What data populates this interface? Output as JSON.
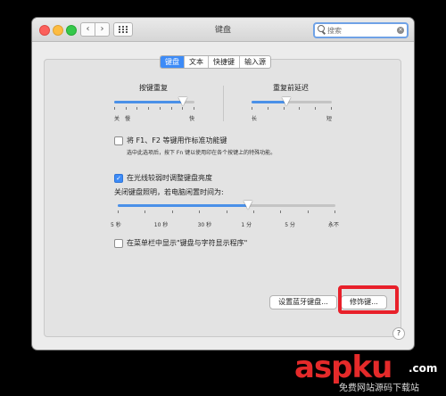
{
  "window": {
    "title": "键盘"
  },
  "toolbar": {
    "back_glyph": "‹",
    "forward_glyph": "›"
  },
  "search": {
    "placeholder": "搜索",
    "clear_glyph": "×"
  },
  "tabs": [
    {
      "label": "键盘",
      "active": true
    },
    {
      "label": "文本",
      "active": false
    },
    {
      "label": "快捷键",
      "active": false
    },
    {
      "label": "输入源",
      "active": false
    }
  ],
  "key_repeat": {
    "title": "按键重复",
    "min_label_1": "关",
    "min_label_2": "慢",
    "max_label": "快",
    "value_fraction": 0.85
  },
  "delay_until_repeat": {
    "title": "重复前延迟",
    "min_label": "长",
    "max_label": "短",
    "value_fraction": 0.43
  },
  "fn_keys": {
    "checked": false,
    "label": "将 F1、F2 等键用作标准功能键",
    "note": "选中此选项后，按下 Fn 键以使用印在各个按键上的特殊功能。"
  },
  "backlight": {
    "checked": true,
    "checkmark": "✓",
    "label": "在光线较弱时调整键盘亮度",
    "timeout_label": "关闭键盘照明，若电脑闲置时间为:",
    "ticks": [
      "5 秒",
      "10 秒",
      "30 秒",
      "1 分",
      "5 分",
      "永不"
    ],
    "value_fraction": 0.6
  },
  "menu_bar": {
    "checked": false,
    "label": "在菜单栏中显示\"键盘与字符显示程序\""
  },
  "buttons": {
    "bluetooth": "设置蓝牙键盘...",
    "modifier": "修饰键..."
  },
  "help": {
    "glyph": "?"
  },
  "watermark": {
    "main": "aspku",
    "suffix": ".com",
    "sub": "免费网站源码下载站"
  },
  "colors": {
    "accent": "#3d8bf7",
    "highlight": "#e8202a"
  }
}
